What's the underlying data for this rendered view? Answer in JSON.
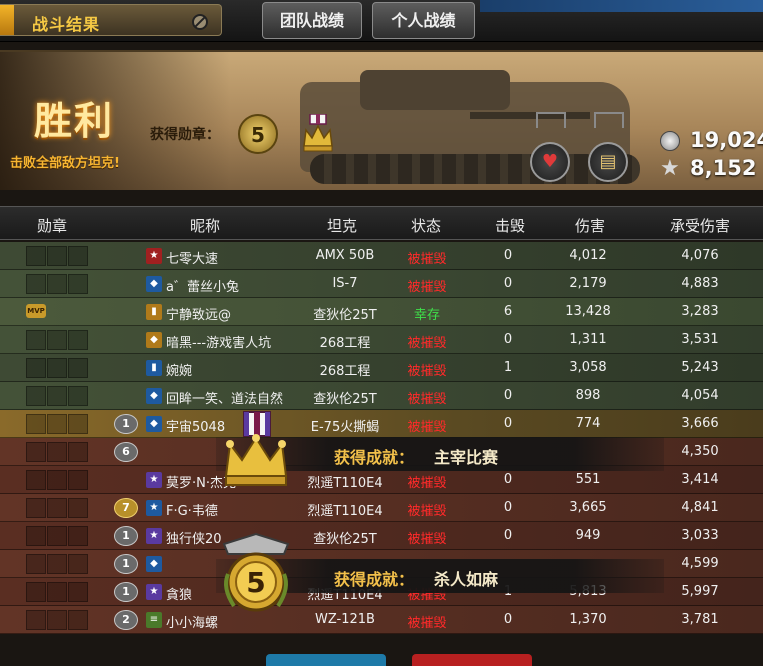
{
  "header": {
    "title": "战斗结果",
    "tabs": [
      "团队战绩",
      "个人战绩"
    ]
  },
  "banner": {
    "result": "胜利",
    "result_sub": "击败全部敌方坦克!",
    "medals_label": "获得勋章：",
    "medal_round_value": "5",
    "silver": "19,024",
    "xp": "8,152"
  },
  "table": {
    "headers": {
      "medal": "勋章",
      "nickname": "昵称",
      "tank": "坦克",
      "status": "状态",
      "kills": "击毁",
      "damage": "伤害",
      "taken": "承受伤害"
    },
    "rows": [
      {
        "rank": "",
        "class": "★",
        "name": "七零大速",
        "tank": "AMX 50B",
        "status": "被摧毁",
        "kills": "0",
        "damage": "4,012",
        "taken": "4,076"
      },
      {
        "rank": "",
        "class": "◆",
        "name": "a゛蕾丝小兔",
        "tank": "IS-7",
        "status": "被摧毁",
        "kills": "0",
        "damage": "2,179",
        "taken": "4,883"
      },
      {
        "rank": "",
        "class": "▮",
        "name": "宁静致远@",
        "tank": "查狄伦25T",
        "status": "幸存",
        "kills": "6",
        "damage": "13,428",
        "taken": "3,283",
        "mvp": "MVP"
      },
      {
        "rank": "",
        "class": "◆",
        "name": "暗黑---游戏害人坑",
        "tank": "268工程",
        "status": "被摧毁",
        "kills": "0",
        "damage": "1,311",
        "taken": "3,531"
      },
      {
        "rank": "",
        "class": "▮",
        "name": "婉婉",
        "tank": "268工程",
        "status": "被摧毁",
        "kills": "1",
        "damage": "3,058",
        "taken": "5,243"
      },
      {
        "rank": "",
        "class": "◆",
        "name": "回眸一笑、道法自然",
        "tank": "查狄伦25T",
        "status": "被摧毁",
        "kills": "0",
        "damage": "898",
        "taken": "4,054"
      },
      {
        "rank": "1",
        "class": "◆",
        "name": "宇宙5048",
        "tank": "E-75火撕蝎",
        "status": "被摧毁",
        "kills": "0",
        "damage": "774",
        "taken": "3,666"
      },
      {
        "rank": "6",
        "class": "",
        "name": "",
        "tank": "",
        "status": "",
        "kills": "",
        "damage": "",
        "taken": "4,350"
      },
      {
        "rank": "",
        "class": "★",
        "name": "莫罗·N·杰克",
        "tank": "烈遥T110E4",
        "status": "被摧毁",
        "kills": "0",
        "damage": "551",
        "taken": "3,414"
      },
      {
        "rank": "7",
        "class": "★",
        "name": "F·G·韦德",
        "tank": "烈遥T110E4",
        "status": "被摧毁",
        "kills": "0",
        "damage": "3,665",
        "taken": "4,841"
      },
      {
        "rank": "1",
        "class": "★",
        "name": "独行侠20",
        "tank": "查狄伦25T",
        "status": "被摧毁",
        "kills": "0",
        "damage": "949",
        "taken": "3,033"
      },
      {
        "rank": "1",
        "class": "◆",
        "name": "",
        "tank": "",
        "status": "",
        "kills": "",
        "damage": "",
        "taken": "4,599"
      },
      {
        "rank": "1",
        "class": "★",
        "name": "貪狼",
        "tank": "烈遥T110E4",
        "status": "被摧毁",
        "kills": "1",
        "damage": "5,813",
        "taken": "5,997"
      },
      {
        "rank": "2",
        "class": "≡",
        "name": "小小海螺",
        "tank": "WZ-121B",
        "status": "被摧毁",
        "kills": "0",
        "damage": "1,370",
        "taken": "3,781"
      }
    ]
  },
  "achievements": [
    {
      "label": "获得成就：",
      "name": "主宰比赛"
    },
    {
      "label": "获得成就：",
      "name": "杀人如麻"
    }
  ],
  "big_medal_value": "5",
  "colors": {
    "destroyed": "#ff2a2a",
    "survived": "#3fe04a",
    "gold_accent": "#f2c04a"
  }
}
